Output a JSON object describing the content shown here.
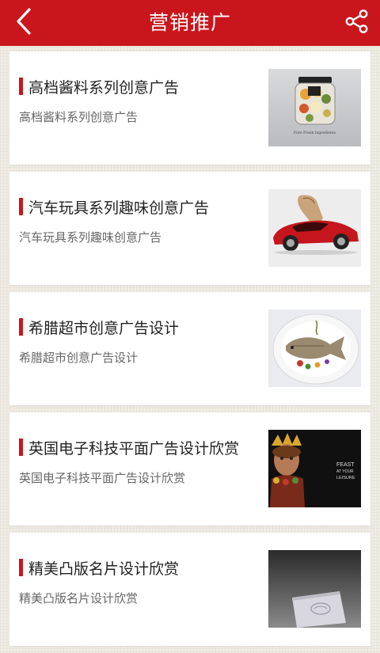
{
  "header": {
    "title": "营销推广",
    "back_icon": "chevron-left-icon",
    "share_icon": "share-icon",
    "bar_color": "#c9161c"
  },
  "items": [
    {
      "title": "高档酱料系列创意广告",
      "subtitle": "高档酱料系列创意广告",
      "image": "sauce-jar-ad-image",
      "image_caption": "Pure Fresh Ingredients"
    },
    {
      "title": "汽车玩具系列趣味创意广告",
      "subtitle": "汽车玩具系列趣味创意广告",
      "image": "toy-car-shoe-ad-image"
    },
    {
      "title": "希腊超市创意广告设计",
      "subtitle": "希腊超市创意广告设计",
      "image": "fish-plate-ad-image"
    },
    {
      "title": "英国电子科技平面广告设计欣赏",
      "subtitle": "英国电子科技平面广告设计欣赏",
      "image": "feast-at-your-leisure-ad-image",
      "image_caption_lines": [
        "FEAST",
        "AT YOUR",
        "LEISURE"
      ]
    },
    {
      "title": "精美凸版名片设计欣赏",
      "subtitle": "精美凸版名片设计欣赏",
      "image": "letterpress-business-card-image"
    }
  ]
}
